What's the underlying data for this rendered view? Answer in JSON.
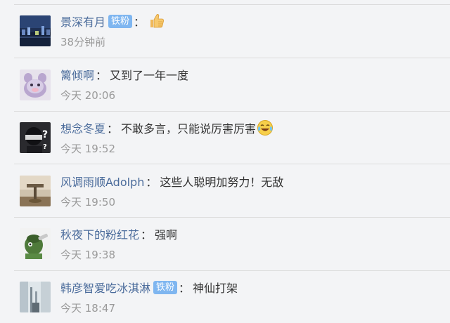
{
  "comments": [
    {
      "username": "景深有月",
      "badge": "铁粉",
      "colon": "：",
      "content": "",
      "emoji": "thumbs-up-icon",
      "time": "38分钟前"
    },
    {
      "username": "篱倾啊",
      "badge": "",
      "colon": "：",
      "content": "又到了一年一度",
      "emoji": "",
      "time": "今天 20:06"
    },
    {
      "username": "想念冬夏",
      "badge": "",
      "colon": "：",
      "content": "不敢多言，只能说厉害厉害",
      "emoji": "laughing-crying-icon",
      "time": "今天 19:52"
    },
    {
      "username": "风调雨顺Adolph",
      "badge": "",
      "colon": "：",
      "content": "这些人聪明加努力！无敌",
      "emoji": "",
      "time": "今天 19:50"
    },
    {
      "username": "秋夜下的粉红花",
      "badge": "",
      "colon": "：",
      "content": "强啊",
      "emoji": "",
      "time": "今天 19:38"
    },
    {
      "username": "韩彦智爱吃冰淇淋",
      "badge": "铁粉",
      "colon": "：",
      "content": "神仙打架",
      "emoji": "",
      "time": "今天 18:47"
    }
  ],
  "colors": {
    "background": "#f3f4f6",
    "username": "#4a6b9b",
    "badge": "#7fb6f0",
    "text": "#333333",
    "time": "#9a9a9a",
    "divider": "#dcdcdc"
  }
}
